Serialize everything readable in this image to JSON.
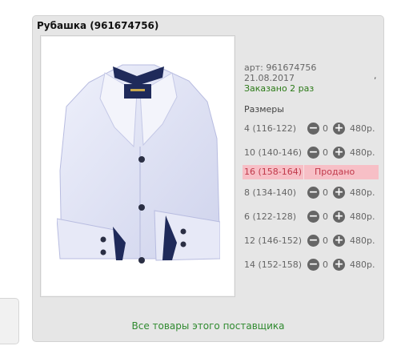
{
  "product": {
    "title": "Рубашка (961674756)",
    "article": "арт: 961674756",
    "date": "21.08.2017",
    "ordered": "Заказано 2 раз",
    "side_mark": ","
  },
  "sizes": {
    "heading": "Размеры",
    "items": [
      {
        "label": "4 (116-122)",
        "qty": "0",
        "price": "480р.",
        "sold": false
      },
      {
        "label": "10 (140-146)",
        "qty": "0",
        "price": "480р.",
        "sold": false
      },
      {
        "label": "16 (158-164)",
        "sold": true,
        "sold_text": "Продано"
      },
      {
        "label": "8 (134-140)",
        "qty": "0",
        "price": "480р.",
        "sold": false
      },
      {
        "label": "6 (122-128)",
        "qty": "0",
        "price": "480р.",
        "sold": false
      },
      {
        "label": "12 (146-152)",
        "qty": "0",
        "price": "480р.",
        "sold": false
      },
      {
        "label": "14 (152-158)",
        "qty": "0",
        "price": "480р.",
        "sold": false
      }
    ]
  },
  "footer": {
    "link": "Все товары этого поставщика"
  },
  "icons": {
    "minus": "minus-icon",
    "plus": "plus-icon"
  },
  "colors": {
    "sold_bg": "#f7bfc6",
    "link": "#2f8a2f",
    "ordered": "#2b7a17"
  }
}
